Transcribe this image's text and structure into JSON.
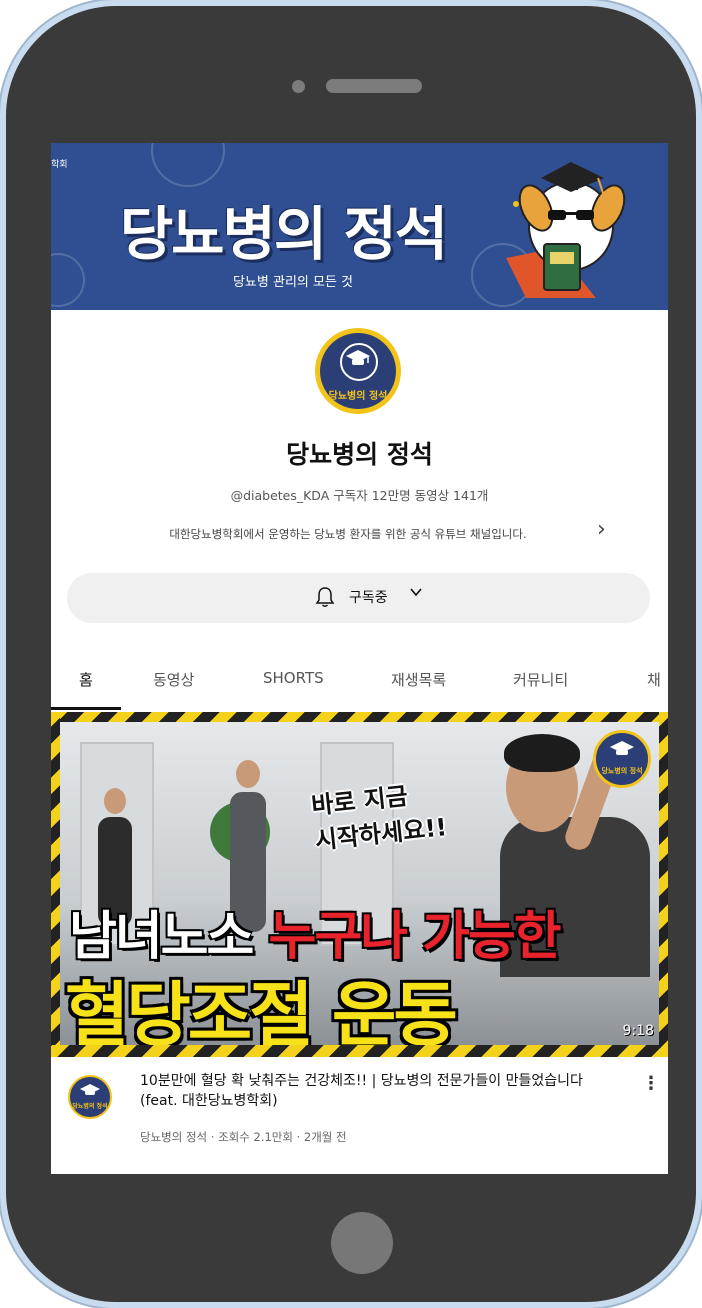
{
  "banner": {
    "title": "당뇨병의 정석",
    "subtitle": "당뇨병 관리의 모든 것",
    "edge_text": "학회"
  },
  "channel": {
    "avatar_label": "당뇨병의 정석",
    "name": "당뇨병의 정석",
    "meta": "@diabetes_KDA  구독자 12만명  동영상 141개",
    "description": "대한당뇨병학회에서 운영하는 당뇨병 환자를 위한 공식 유튜브 채널입니다.",
    "subscribe_label": "구독중"
  },
  "tabs": [
    {
      "label": "홈",
      "active": true
    },
    {
      "label": "동영상"
    },
    {
      "label": "SHORTS"
    },
    {
      "label": "재생목록"
    },
    {
      "label": "커뮤니티"
    },
    {
      "label": "채"
    }
  ],
  "video": {
    "thumbnail": {
      "speech_1": "바로 지금",
      "speech_2": "시작하세요!!",
      "headline_white": "남녀노소",
      "headline_red": "누구나 가능한",
      "headline_yellow": "혈당조절 운동",
      "logo_label": "당뇨병의 정석",
      "duration": "9:18"
    },
    "avatar_label": "당뇨병의 정석",
    "title": "10분만에 혈당 확 낮춰주는 건강체조!! | 당뇨병의 전문가들이 만들었습니다 (feat. 대한당뇨병학회)",
    "meta": "당뇨병의 정석 · 조회수 2.1만회 · 2개월 전"
  },
  "colors": {
    "banner_bg": "#2f4f92",
    "accent_yellow": "#f2c318",
    "headline_red": "#e8232c"
  },
  "icons": [
    "bell-icon",
    "chevron-down-icon",
    "chevron-right-icon",
    "more-vert-icon",
    "graduation-cap-icon"
  ]
}
